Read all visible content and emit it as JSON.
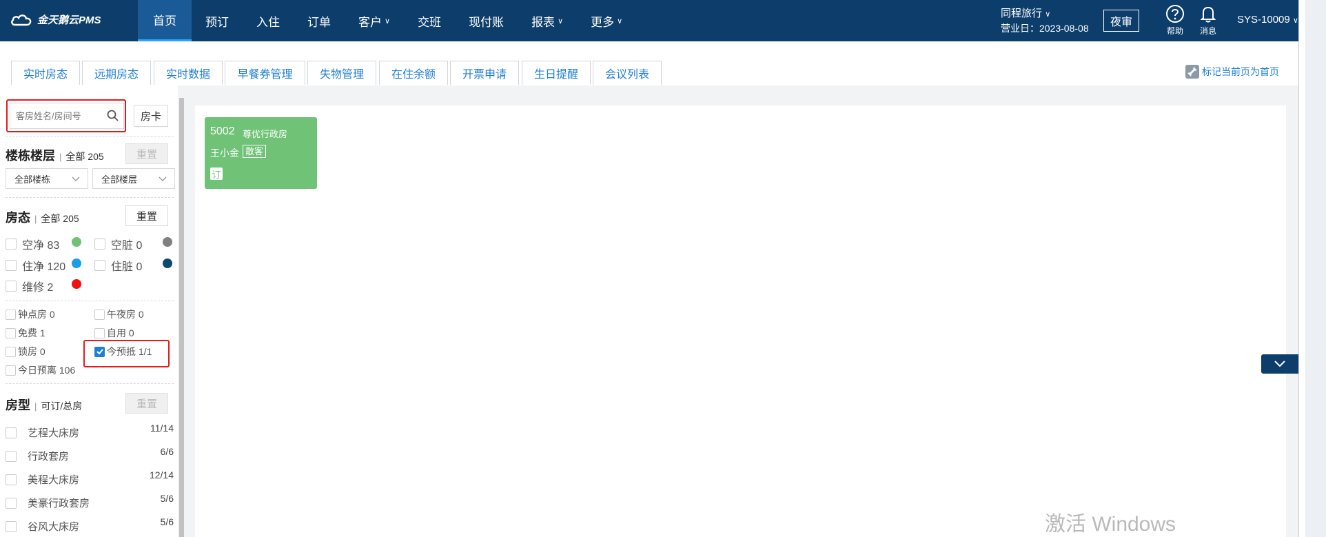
{
  "app": {
    "logo_text": "金天鹅云PMS"
  },
  "nav": [
    {
      "label": "首页",
      "active": true,
      "dropdown": false
    },
    {
      "label": "预订",
      "active": false,
      "dropdown": false
    },
    {
      "label": "入住",
      "active": false,
      "dropdown": false
    },
    {
      "label": "订单",
      "active": false,
      "dropdown": false
    },
    {
      "label": "客户",
      "active": false,
      "dropdown": true
    },
    {
      "label": "交班",
      "active": false,
      "dropdown": false
    },
    {
      "label": "现付账",
      "active": false,
      "dropdown": false
    },
    {
      "label": "报表",
      "active": false,
      "dropdown": true
    },
    {
      "label": "更多",
      "active": false,
      "dropdown": true
    }
  ],
  "header": {
    "hotel_name": "同程旅行",
    "business_day": "营业日：2023-08-08",
    "night_audit": "夜审",
    "help_label": "帮助",
    "messages_label": "消息",
    "user": "SYS-10009"
  },
  "tabs": [
    "实时房态",
    "远期房态",
    "实时数据",
    "早餐券管理",
    "失物管理",
    "在住余额",
    "开票申请",
    "生日提醒",
    "会议列表"
  ],
  "mark_home": "标记当前页为首页",
  "sidebar": {
    "search_placeholder": "客房姓名/房间号",
    "room_card_btn": "房卡",
    "building": {
      "title": "楼栋楼层",
      "count": "全部 205",
      "reset": "重置",
      "building_select": "全部楼栋",
      "floor_select": "全部楼层"
    },
    "status": {
      "title": "房态",
      "count": "全部 205",
      "reset": "重置",
      "items": [
        {
          "label": "空净 83",
          "color": "#6fc276"
        },
        {
          "label": "空脏 0",
          "color": "#808080"
        },
        {
          "label": "住净 120",
          "color": "#1a9ee8"
        },
        {
          "label": "住脏 0",
          "color": "#0d4a72"
        },
        {
          "label": "维修 2",
          "color": "#ee1111"
        }
      ]
    },
    "flags": [
      {
        "label": "钟点房 0",
        "checked": false
      },
      {
        "label": "午夜房 0",
        "checked": false
      },
      {
        "label": "免费 1",
        "checked": false
      },
      {
        "label": "自用 0",
        "checked": false
      },
      {
        "label": "锁房 0",
        "checked": false
      },
      {
        "label": "今预抵 1/1",
        "checked": true
      },
      {
        "label": "今日预离 106",
        "checked": false
      }
    ],
    "room_types": {
      "title": "房型",
      "count": "可订/总房",
      "reset": "重置",
      "items": [
        {
          "name": "艺程大床房",
          "avail": "11/14"
        },
        {
          "name": "行政套房",
          "avail": "6/6"
        },
        {
          "name": "美程大床房",
          "avail": "12/14"
        },
        {
          "name": "美豪行政套房",
          "avail": "5/6"
        },
        {
          "name": "谷风大床房",
          "avail": "5/6"
        }
      ]
    }
  },
  "room": {
    "number": "5002",
    "type": "尊优行政房",
    "guest": "王小金",
    "tag": "散客",
    "badge": "订"
  },
  "watermark": "激活 Windows"
}
